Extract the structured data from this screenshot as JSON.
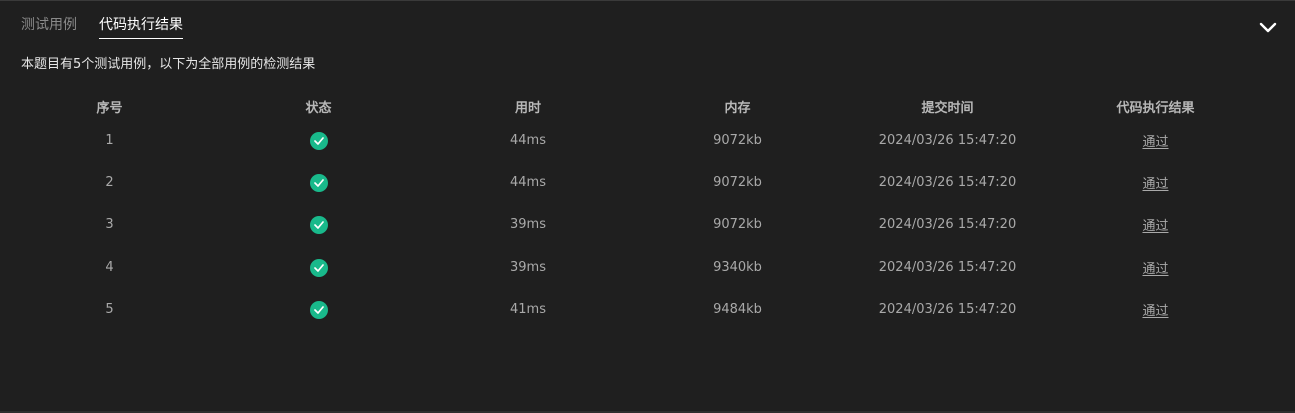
{
  "tabs": [
    {
      "label": "测试用例",
      "active": false
    },
    {
      "label": "代码执行结果",
      "active": true
    }
  ],
  "summary": "本题目有5个测试用例，以下为全部用例的检测结果",
  "table": {
    "headers": [
      "序号",
      "状态",
      "用时",
      "内存",
      "提交时间",
      "代码执行结果"
    ],
    "rows": [
      {
        "index": "1",
        "status_icon": "check-circle-icon",
        "time": "44ms",
        "memory": "9072kb",
        "submitted": "2024/03/26 15:47:20",
        "result": "通过"
      },
      {
        "index": "2",
        "status_icon": "check-circle-icon",
        "time": "44ms",
        "memory": "9072kb",
        "submitted": "2024/03/26 15:47:20",
        "result": "通过"
      },
      {
        "index": "3",
        "status_icon": "check-circle-icon",
        "time": "39ms",
        "memory": "9072kb",
        "submitted": "2024/03/26 15:47:20",
        "result": "通过"
      },
      {
        "index": "4",
        "status_icon": "check-circle-icon",
        "time": "39ms",
        "memory": "9340kb",
        "submitted": "2024/03/26 15:47:20",
        "result": "通过"
      },
      {
        "index": "5",
        "status_icon": "check-circle-icon",
        "time": "41ms",
        "memory": "9484kb",
        "submitted": "2024/03/26 15:47:20",
        "result": "通过"
      }
    ]
  },
  "icons": {
    "collapse": "chevron-down-icon"
  },
  "colors": {
    "background": "#1f1f1f",
    "success": "#19b98b",
    "active_tab": "#ffffff",
    "inactive_tab": "#8a8a8a"
  }
}
